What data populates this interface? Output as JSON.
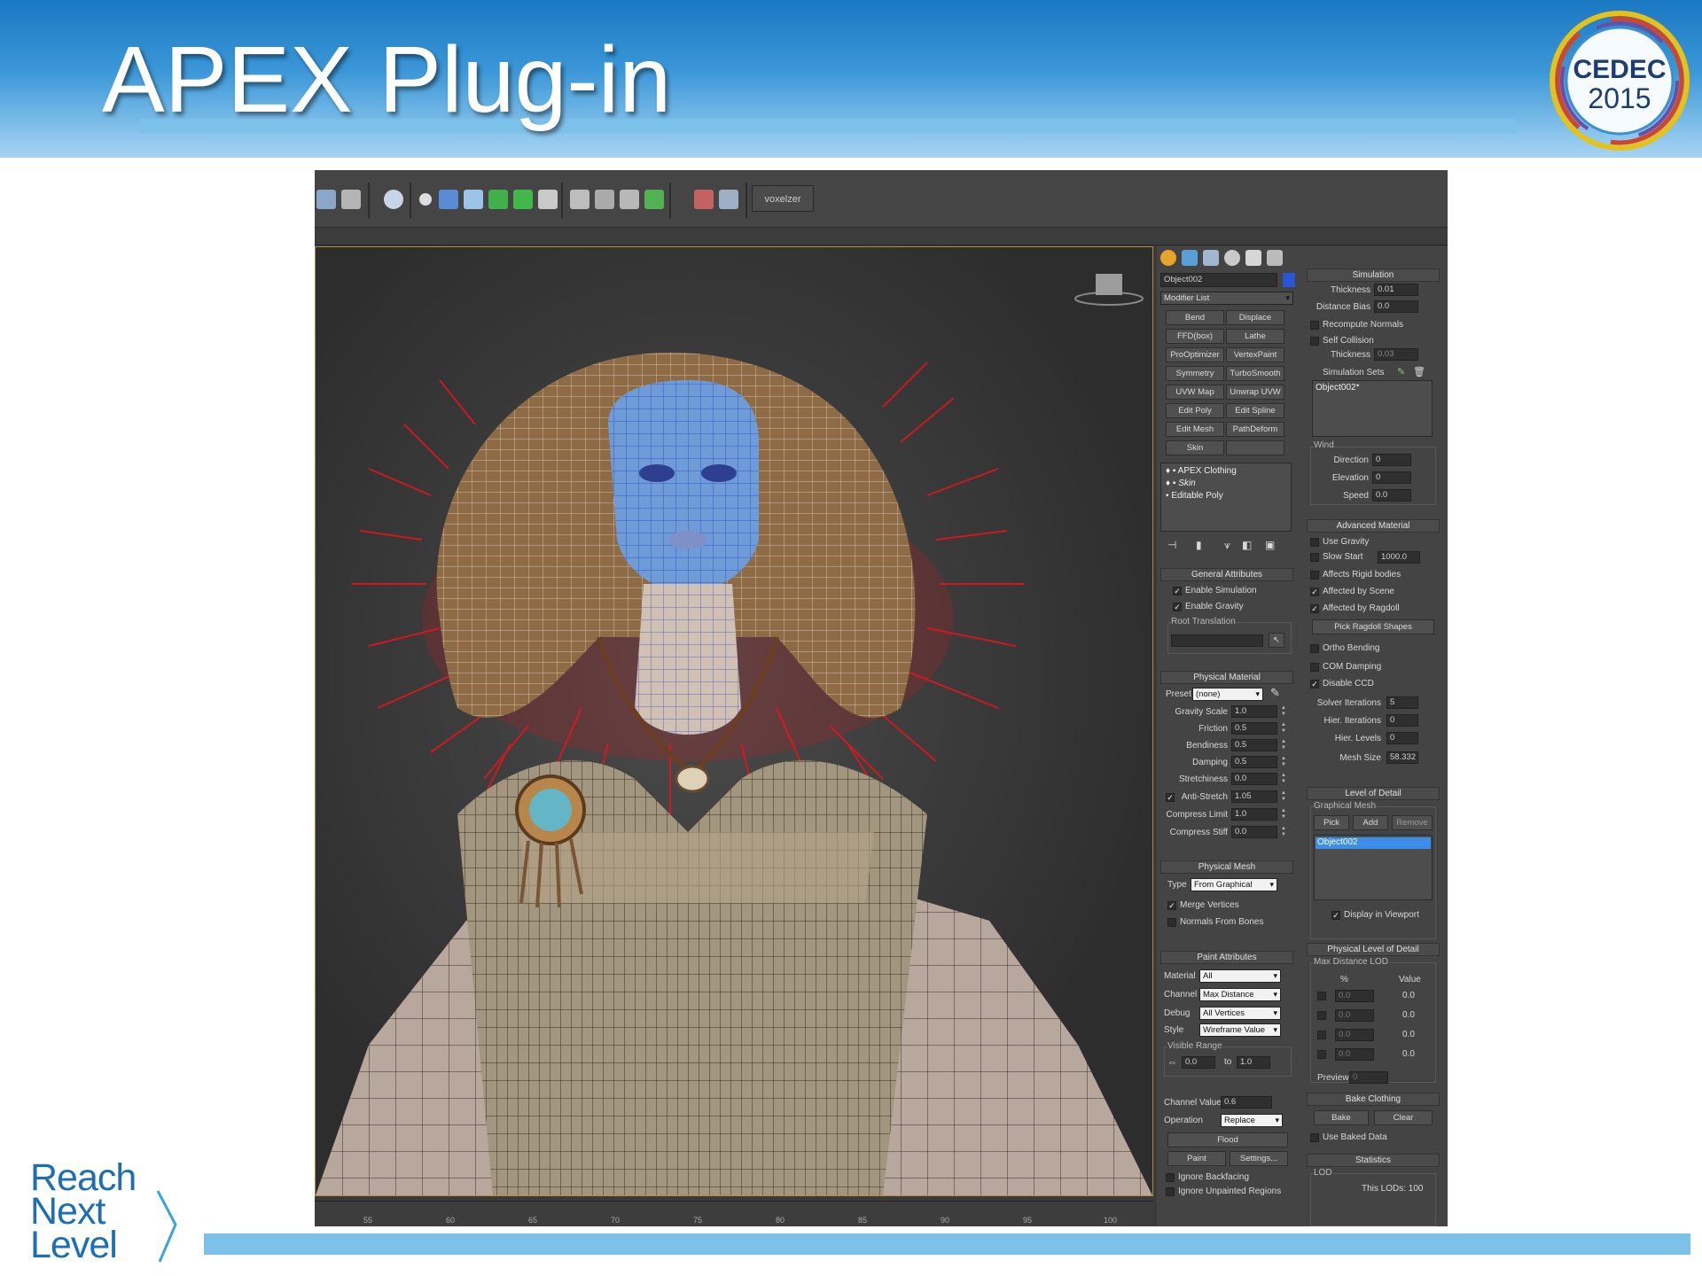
{
  "slide": {
    "title": "APEX Plug-in",
    "cedec": {
      "name": "CEDEC",
      "year": "2015"
    },
    "footer_logo": [
      "Reach",
      "Next",
      "Level"
    ]
  },
  "colors": {
    "header": "#2b8bd0",
    "accent_bar": "#7cc1ea",
    "mesh_red": "#e8141a",
    "selection_blue": "#3b8fe8"
  },
  "toolbar": {
    "voxelizer_label": "voxelzer",
    "icons": [
      "teapot-icon",
      "render-icon",
      "sphere-icon",
      "clothing-icon",
      "cloth-sim-icon",
      "hair-icon",
      "bottle-icon",
      "hammer-icon",
      "export-icon",
      "play-icon",
      "record-icon",
      "screen-icon",
      "link-icon",
      "swap-icon"
    ]
  },
  "ruler_ticks": [
    "55",
    "60",
    "65",
    "70",
    "75",
    "80",
    "85",
    "90",
    "95",
    "100"
  ],
  "cmd": {
    "tab_icons": [
      "sun-icon",
      "modify-icon",
      "hierarchy-icon",
      "motion-icon",
      "display-icon",
      "utilities-icon"
    ],
    "object_name": "Object002",
    "modifier_list": "Modifier List",
    "modifier_buttons": [
      "Bend",
      "Displace",
      "FFD(box)",
      "Lathe",
      "ProOptimizer",
      "VertexPaint",
      "Symmetry",
      "TurboSmooth",
      "UVW Map",
      "Unwrap UVW",
      "Edit Poly",
      "Edit Spline",
      "Edit Mesh",
      "PathDeform",
      "Skin",
      ""
    ],
    "stack": [
      "APEX Clothing",
      "Skin",
      "Editable Poly"
    ],
    "general": {
      "title": "General Attributes",
      "enable_sim": "Enable Simulation",
      "enable_grav": "Enable Gravity",
      "root": "Root Translation"
    },
    "physical_material": {
      "title": "Physical Material",
      "preset_label": "Preset",
      "preset": "(none)",
      "rows": [
        {
          "label": "Gravity Scale",
          "value": "1.0"
        },
        {
          "label": "Friction",
          "value": "0.5"
        },
        {
          "label": "Bendiness",
          "value": "0.5"
        },
        {
          "label": "Damping",
          "value": "0.5"
        },
        {
          "label": "Stretchiness",
          "value": "0.0"
        },
        {
          "label": "Anti-Stretch",
          "value": "1.05"
        },
        {
          "label": "Compress Limit",
          "value": "1.0"
        },
        {
          "label": "Compress Stiff",
          "value": "0.0"
        }
      ]
    },
    "physical_mesh": {
      "title": "Physical Mesh",
      "type_label": "Type",
      "type": "From Graphical",
      "merge": "Merge Vertices",
      "normals": "Normals From Bones"
    },
    "paint": {
      "title": "Paint Attributes",
      "material_label": "Material",
      "material": "All",
      "channel_label": "Channel",
      "channel": "Max Distance",
      "debug_label": "Debug",
      "debug": "All Vertices",
      "style_label": "Style",
      "style": "Wireframe Value",
      "visible_range": "Visible Range",
      "range_from": "0.0",
      "to": "to",
      "range_to": "1.0",
      "channel_value_label": "Channel Value",
      "channel_value": "0.6",
      "operation_label": "Operation",
      "operation": "Replace",
      "flood": "Flood",
      "paint_btn": "Paint",
      "settings_btn": "Settings...",
      "ignore_backfacing": "Ignore Backfacing",
      "ignore_unpainted": "Ignore Unpainted Regions"
    },
    "simulation": {
      "title": "Simulation",
      "thickness_label": "Thickness",
      "thickness": "0.01",
      "distance_bias_label": "Distance Bias",
      "distance_bias": "0.0",
      "recompute": "Recompute Normals",
      "self_collision": "Self Collision",
      "thickness2_label": "Thickness",
      "thickness2": "0.03",
      "sim_sets": "Simulation Sets",
      "sim_set_item": "Object002*",
      "wind": "Wind",
      "direction_label": "Direction",
      "direction": "0",
      "elevation_label": "Elevation",
      "elevation": "0",
      "speed_label": "Speed",
      "speed": "0.0"
    },
    "advanced": {
      "title": "Advanced Material",
      "use_gravity": "Use Gravity",
      "slow_start": "Slow Start",
      "slow_start_value": "1000.0",
      "affects_rigid": "Affects Rigid bodies",
      "affected_scene": "Affected by Scene",
      "affected_ragdoll": "Affected by Ragdoll",
      "pick_ragdoll": "Pick Ragdoll Shapes",
      "ortho": "Ortho Bending",
      "com": "COM Damping",
      "disable_ccd": "Disable CCD",
      "solver_label": "Solver Iterations",
      "solver": "5",
      "hier_iter_label": "Hier. Iterations",
      "hier_iter": "0",
      "hier_levels_label": "Hier. Levels",
      "hier_levels": "0",
      "mesh_size_label": "Mesh Size",
      "mesh_size": "58.332"
    },
    "lod": {
      "title": "Level of Detail",
      "graphical_mesh": "Graphical Mesh",
      "pick": "Pick",
      "add": "Add",
      "remove": "Remove",
      "item": "Object002",
      "display": "Display in Viewport"
    },
    "physical_lod": {
      "title": "Physical Level of Detail",
      "max_dist": "Max Distance LOD",
      "pct": "%",
      "value_col": "Value",
      "rows": [
        {
          "pct": "0.0",
          "value": "0.0"
        },
        {
          "pct": "0.0",
          "value": "0.0"
        },
        {
          "pct": "0.0",
          "value": "0.0"
        },
        {
          "pct": "0.0",
          "value": "0.0"
        }
      ],
      "preview_label": "Preview",
      "preview": "0"
    },
    "bake": {
      "title": "Bake Clothing",
      "bake": "Bake",
      "clear": "Clear",
      "use_baked": "Use Baked Data"
    },
    "stats": {
      "title": "Statistics",
      "lod": "LOD",
      "this_lods": "This LODs: 100"
    }
  }
}
